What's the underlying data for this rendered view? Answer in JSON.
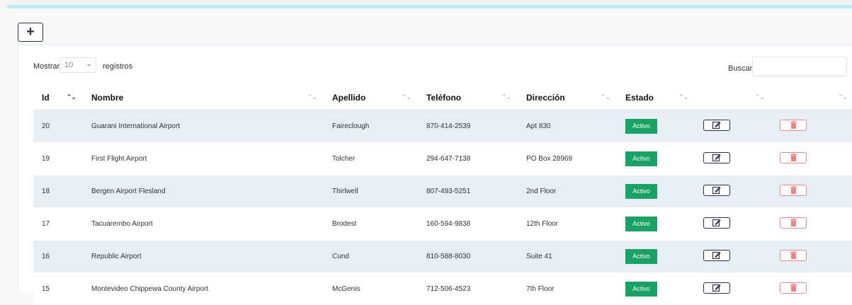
{
  "toolbar": {
    "add_label": "+"
  },
  "length": {
    "prefix": "Mostrar",
    "value": "10",
    "suffix": "registros"
  },
  "search": {
    "label": "Buscar:",
    "value": ""
  },
  "colors": {
    "badge": "#18a263",
    "row_alt": "#e7eef6",
    "delete": "#e98787",
    "accent": "#bfeaf3"
  },
  "columns": [
    "Id",
    "Nombre",
    "Apellido",
    "Teléfono",
    "Dirección",
    "Estado",
    "",
    ""
  ],
  "rows": [
    {
      "id": "20",
      "nombre": "Guarani International Airport",
      "apellido": "Faireclough",
      "telefono": "870-414-2539",
      "direccion": "Apt 830",
      "estado": "Activo"
    },
    {
      "id": "19",
      "nombre": "First Flight Airport",
      "apellido": "Tolcher",
      "telefono": "294-647-7138",
      "direccion": "PO Box 28969",
      "estado": "Activo"
    },
    {
      "id": "18",
      "nombre": "Bergen Airport Flesland",
      "apellido": "Thirlwell",
      "telefono": "807-493-5251",
      "direccion": "2nd Floor",
      "estado": "Activo"
    },
    {
      "id": "17",
      "nombre": "Tacuarembo Airport",
      "apellido": "Brodest",
      "telefono": "160-594-9838",
      "direccion": "12th Floor",
      "estado": "Activo"
    },
    {
      "id": "16",
      "nombre": "Republic Airport",
      "apellido": "Cund",
      "telefono": "810-588-8030",
      "direccion": "Suite 41",
      "estado": "Activo"
    },
    {
      "id": "15",
      "nombre": "Montevideo Chippewa County Airport",
      "apellido": "McGenis",
      "telefono": "712-506-4523",
      "direccion": "7th Floor",
      "estado": "Activo"
    }
  ]
}
